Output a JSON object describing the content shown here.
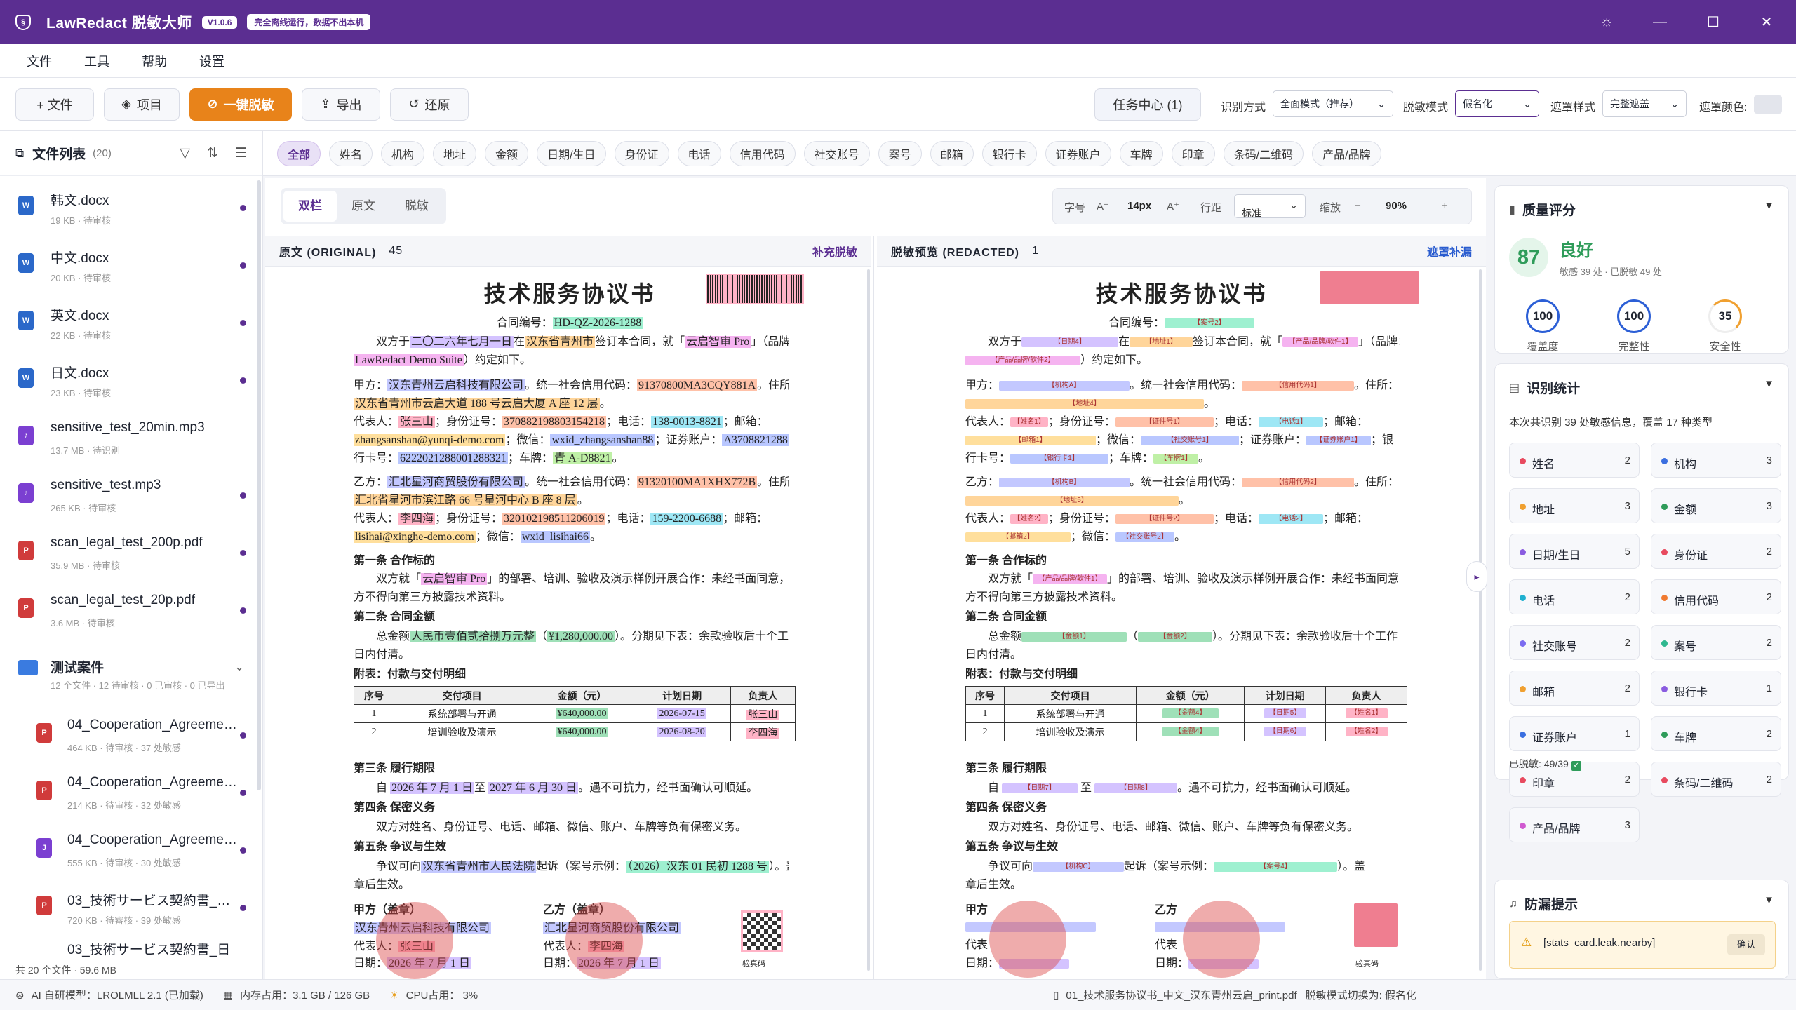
{
  "app": {
    "title": "LawRedact 脱敏大师",
    "version": "V1.0.6",
    "offline": "完全离线运行，数据不出本机"
  },
  "menu": [
    "文件",
    "工具",
    "帮助",
    "设置"
  ],
  "toolbar": {
    "file": "+ 文件",
    "project": "项目",
    "oneclick": "一键脱敏",
    "export": "导出",
    "restore": "还原",
    "task": "任务中心 (1)",
    "recog_label": "识别方式",
    "recog_value": "全面模式（推荐）",
    "mode_label": "脱敏模式",
    "mode_value": "假名化",
    "mask_label": "遮罩样式",
    "mask_value": "完整遮盖",
    "color_label": "遮罩颜色:"
  },
  "sidebar": {
    "title": "文件列表",
    "count": "(20)",
    "files": [
      {
        "name": "韩文.docx",
        "meta": "19 KB · 待审核",
        "type": "W"
      },
      {
        "name": "中文.docx",
        "meta": "20 KB · 待审核",
        "type": "W"
      },
      {
        "name": "英文.docx",
        "meta": "22 KB · 待审核",
        "type": "W"
      },
      {
        "name": "日文.docx",
        "meta": "23 KB · 待审核",
        "type": "W"
      },
      {
        "name": "sensitive_test_20min.mp3",
        "meta": "13.7 MB · 待识别",
        "type": "♪"
      },
      {
        "name": "sensitive_test.mp3",
        "meta": "265 KB · 待审核",
        "type": "♪"
      },
      {
        "name": "scan_legal_test_200p.pdf",
        "meta": "35.9 MB · 待审核",
        "type": "P"
      },
      {
        "name": "scan_legal_test_20p.pdf",
        "meta": "3.6 MB · 待审核",
        "type": "P"
      }
    ],
    "folder": {
      "name": "测试案件",
      "meta": "12 个文件 · 12 待审核 · 0 已审核 · 0 已导出"
    },
    "subfiles": [
      {
        "name": "04_Cooperation_Agreement_EN.pdf",
        "meta": "464 KB · 待审核 · 37 处敏感",
        "type": "P"
      },
      {
        "name": "04_Cooperation_Agreement_EN_print.pdf",
        "meta": "214 KB · 待审核 · 32 处敏感",
        "type": "P"
      },
      {
        "name": "04_Cooperation_Agreement_EN.jpg",
        "meta": "555 KB · 待审核 · 30 处敏感",
        "type": "J"
      },
      {
        "name": "03_技術サービス契約書_日本語.pdf",
        "meta": "720 KB · 待審核 · 39 处敏感",
        "type": "P"
      },
      {
        "name": "03_技術サービス契約書_日",
        "meta": "",
        "type": "P"
      }
    ],
    "footer": "共 20 个文件 · 59.6 MB"
  },
  "filters": [
    "全部",
    "姓名",
    "机构",
    "地址",
    "金额",
    "日期/生日",
    "身份证",
    "电话",
    "信用代码",
    "社交账号",
    "案号",
    "邮箱",
    "银行卡",
    "证券账户",
    "车牌",
    "印章",
    "条码/二维码",
    "产品/品牌"
  ],
  "view": {
    "tabs": [
      "双栏",
      "原文",
      "脱敏"
    ],
    "font_label": "字号",
    "font_dec": "A⁻",
    "font_size": "14px",
    "font_inc": "A⁺",
    "line_label": "行距",
    "line_value": "标准",
    "zoom_label": "缩放",
    "zoom_minus": "−",
    "zoom_value": "90%",
    "zoom_plus": "+"
  },
  "original": {
    "header": "原文 (ORIGINAL)",
    "count": "45",
    "action": "补充脱敏"
  },
  "redacted": {
    "header": "脱敏预览 (REDACTED)",
    "count": "1",
    "action": "遮罩补漏"
  },
  "doc": {
    "title": "技术服务协议书",
    "contract_label": "合同编号：",
    "contract_no": "HD-QZ-2026-1288",
    "art1": "第一条 合作标的",
    "art2": "第二条 合同金额",
    "appendix": "附表：付款与交付明细",
    "art3": "第三条 履行期限",
    "art4": "第四条 保密义务",
    "art5": "第五条 争议与生效",
    "table_head": [
      "序号",
      "交付项目",
      "金额（元）",
      "计划日期",
      "负责人"
    ],
    "table_rows": [
      [
        "1",
        "系统部署与开通",
        "¥640,000.00",
        "2026-07-15",
        "张三山"
      ],
      [
        "2",
        "培训验收及演示",
        "¥640,000.00",
        "2026-08-20",
        "李四海"
      ]
    ],
    "red_rows": [
      [
        "1",
        "系统部署与开通",
        "【金额4】",
        "【日期5】",
        "【姓名1】"
      ],
      [
        "2",
        "培训验收及演示",
        "【金额4】",
        "【日期6】",
        "【姓名2】"
      ]
    ],
    "sig_a": "甲方（盖章）",
    "sig_b": "乙方（盖章）",
    "rep": "代表人：",
    "date": "日期：",
    "verify": "验真码"
  },
  "quality": {
    "title": "质量评分",
    "score": "87",
    "grade": "良好",
    "desc": "敏感 39 处 · 已脱敏 49 处",
    "rings": [
      {
        "v": "100",
        "l": "覆盖度"
      },
      {
        "v": "100",
        "l": "完整性"
      },
      {
        "v": "35",
        "l": "安全性"
      }
    ]
  },
  "stats": {
    "title": "识别统计",
    "summary": "本次共识别 39 处敏感信息，覆盖 17 种类型",
    "items": [
      {
        "n": "姓名",
        "c": "2",
        "col": "#e84a5f"
      },
      {
        "n": "机构",
        "c": "3",
        "col": "#3b6fe0"
      },
      {
        "n": "地址",
        "c": "3",
        "col": "#f0a030"
      },
      {
        "n": "金额",
        "c": "3",
        "col": "#2f9c5a"
      },
      {
        "n": "日期/生日",
        "c": "5",
        "col": "#8a5ce0"
      },
      {
        "n": "身份证",
        "c": "2",
        "col": "#e84a5f"
      },
      {
        "n": "电话",
        "c": "2",
        "col": "#1fb0d0"
      },
      {
        "n": "信用代码",
        "c": "2",
        "col": "#f07a30"
      },
      {
        "n": "社交账号",
        "c": "2",
        "col": "#7b6cf0"
      },
      {
        "n": "案号",
        "c": "2",
        "col": "#2fb890"
      },
      {
        "n": "邮箱",
        "c": "2",
        "col": "#f0a030"
      },
      {
        "n": "银行卡",
        "c": "1",
        "col": "#8a5ce0"
      },
      {
        "n": "证券账户",
        "c": "1",
        "col": "#3b6fe0"
      },
      {
        "n": "车牌",
        "c": "2",
        "col": "#2f9c5a"
      },
      {
        "n": "印章",
        "c": "2",
        "col": "#e84a5f"
      },
      {
        "n": "条码/二维码",
        "c": "2",
        "col": "#e84a5f"
      },
      {
        "n": "产品/品牌",
        "c": "3",
        "col": "#d05ad0"
      }
    ],
    "deid": "已脱敏: 49/39"
  },
  "leak": {
    "title": "防漏提示",
    "text": "[stats_card.leak.nearby]",
    "ok": "确认"
  },
  "status": {
    "model": "AI 自研模型：LROLMLL 2.1 (已加载)",
    "mem": "内存占用：3.1 GB / 126 GB",
    "cpu": "CPU占用： 3%",
    "file": "01_技术服务协议书_中文_汉东青州云启_print.pdf",
    "mode": "脱敏模式切换为: 假名化"
  }
}
